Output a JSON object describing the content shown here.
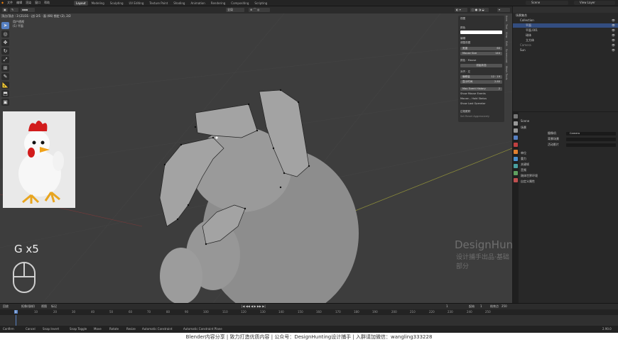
{
  "topbar": {
    "menus": [
      "文件",
      "编辑",
      "渲染",
      "窗口",
      "帮助"
    ],
    "workspace_tabs": [
      "Layout",
      "Modeling",
      "Sculpting",
      "UV Editing",
      "Texture Paint",
      "Shading",
      "Animation",
      "Rendering",
      "Compositing",
      "Scripting"
    ],
    "active_tab": "Layout",
    "scene": "Scene",
    "view_layer": "View Layer"
  },
  "viewport": {
    "info_line": "顶点/顶点 : 3 (21/31 · 边) 2/1 · 面 (66) 锁定 (2), 2/2",
    "user_persp": "用户透视",
    "object_name": "(1) 平面",
    "mode_select": "编辑",
    "overlay_label": "全局",
    "reference_caption": "",
    "keystroke": "G x5",
    "watermark_title": "DesignHunting",
    "watermark_sub": "设计捕手出品·基础部分"
  },
  "npanel": {
    "header": "视图",
    "rows": [
      {
        "label": "颜色",
        "value": ""
      },
      {
        "label": "编辑",
        "value": ""
      },
      {
        "label": "调整视图",
        "value": ""
      },
      {
        "label": "宽度",
        "value": "60"
      },
      {
        "label": "Mouse Size",
        "value": "144"
      },
      {
        "label": "颜色",
        "value": "Mouse"
      },
      {
        "label": "初始状态",
        "value": ""
      },
      {
        "label": "对齐",
        "value": "左"
      },
      {
        "label": "偏移量",
        "value": "12 · 19"
      },
      {
        "label": "显示时间",
        "value": "2.80"
      },
      {
        "label": "Max Event History",
        "value": "2"
      },
      {
        "label": "Show Mouse Events",
        "value": ""
      },
      {
        "label": "Mouse...",
        "value": "Hold Status"
      },
      {
        "label": "Show Last Operator",
        "value": ""
      },
      {
        "label": "过程跟踪",
        "value": ""
      },
      {
        "label": "Set Reset Aggressively",
        "value": ""
      }
    ],
    "vtabs": [
      "Item",
      "Tool",
      "View",
      "Edit",
      "Screencast",
      "Mesh Tools"
    ]
  },
  "outliner": {
    "title": "场景集合",
    "items": [
      {
        "label": "Collection",
        "indent": 2,
        "selected": false
      },
      {
        "label": "平面",
        "indent": 4,
        "selected": true
      },
      {
        "label": "平面.001",
        "indent": 4,
        "selected": false
      },
      {
        "label": "球体",
        "indent": 4,
        "selected": false
      },
      {
        "label": "立方体",
        "indent": 4,
        "selected": false
      },
      {
        "label": "Camera",
        "indent": 2,
        "selected": false
      },
      {
        "label": "Sun",
        "indent": 2,
        "selected": false
      }
    ]
  },
  "properties": {
    "scene_name": "Scene",
    "section": "场景",
    "camera_label": "摄像机",
    "camera_value": "Camera",
    "bg_scene_label": "背景场景",
    "active_clip_label": "活动影片",
    "sections": [
      "单位",
      "重力",
      "关键帧",
      "音频",
      "刚体世界环境",
      "自定义属性"
    ]
  },
  "timeline": {
    "menus": [
      "回放",
      "抠像(插帧)",
      "视图",
      "标记"
    ],
    "current_frame": "1",
    "start_label": "起始",
    "start": "1",
    "end_label": "结束点",
    "end": "250",
    "ruler": [
      "0",
      "10",
      "20",
      "30",
      "40",
      "50",
      "60",
      "70",
      "80",
      "90",
      "100",
      "110",
      "120",
      "130",
      "140",
      "150",
      "160",
      "170",
      "180",
      "190",
      "200",
      "210",
      "220",
      "230",
      "240",
      "250"
    ]
  },
  "statusbar": {
    "items": [
      "Confirm",
      "Cancel",
      "Snap Invert",
      "Snap Toggle",
      "Move",
      "Rotate",
      "Resize",
      "Automatic Constraint",
      "Automatic Constraint Plane"
    ],
    "version": "2.90.0"
  },
  "caption": "Blender内容分享  |  致力打造优质内容  |  公众号：DesignHunting设计捕手  |  入群请加微信：wangling333228"
}
